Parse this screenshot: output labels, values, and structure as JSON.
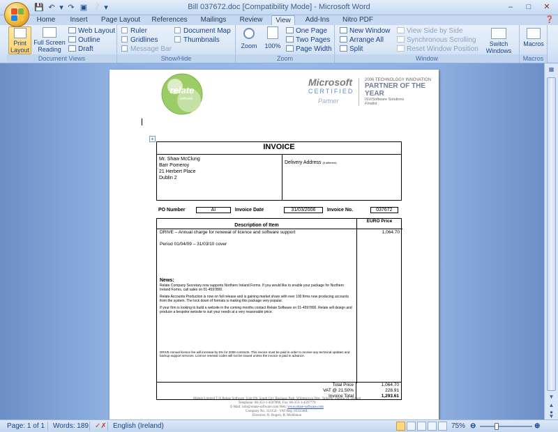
{
  "window": {
    "title": "Bill 037672.doc [Compatibility Mode] - Microsoft Word"
  },
  "tabs": [
    "Home",
    "Insert",
    "Page Layout",
    "References",
    "Mailings",
    "Review",
    "View",
    "Add-Ins",
    "Nitro PDF"
  ],
  "active_tab": "View",
  "ribbon": {
    "document_views": {
      "name": "Document Views",
      "print_layout": "Print Layout",
      "full_screen": "Full Screen Reading",
      "web_layout": "Web Layout",
      "outline": "Outline",
      "draft": "Draft"
    },
    "show_hide": {
      "name": "Show/Hide",
      "ruler": "Ruler",
      "gridlines": "Gridlines",
      "message_bar": "Message Bar",
      "document_map": "Document Map",
      "thumbnails": "Thumbnails"
    },
    "zoom": {
      "name": "Zoom",
      "zoom": "Zoom",
      "hundred": "100%",
      "one_page": "One Page",
      "two_pages": "Two Pages",
      "page_width": "Page Width"
    },
    "window": {
      "name": "Window",
      "new_window": "New Window",
      "arrange_all": "Arrange All",
      "split": "Split",
      "view_side": "View Side by Side",
      "sync_scroll": "Synchronous Scrolling",
      "reset_pos": "Reset Window Position",
      "switch_windows": "Switch Windows"
    },
    "macros": {
      "name": "Macros",
      "macros": "Macros"
    }
  },
  "document": {
    "logo_text": "relate",
    "logo_sub": "software",
    "ms_line1": "Microsoft",
    "ms_line2": "CERTIFIED",
    "ms_line3": "Partner",
    "award_line1": "2006 TECHNOLOGY INNOVATION",
    "award_line2": "PARTNER OF THE YEAR",
    "award_line3": "ISV/Software Solutions",
    "award_line4": "Finalist",
    "invoice_title": "INVOICE",
    "address": [
      "Mr. Shaw McClung",
      "Barr Pomeroy",
      "21 Herbert Place",
      "Dublin 2"
    ],
    "delivery_label": "Delivery Address",
    "delivery_note": "(if different)",
    "po_label": "PO Number",
    "po_value": "AI",
    "date_label": "Invoice Date",
    "date_value": "31/03/2006",
    "invno_label": "Invoice No.",
    "invno_value": "037672",
    "col_desc": "Description of Item",
    "col_price": "EURO Price",
    "item_line": "DRIVE – Annual charge for renewal of licence and software support",
    "item_price": "1,064.70",
    "period": "Period 01/04/09 – 31/03/10 cover",
    "news_title": "News:",
    "news1": "Relate Company Secretary now supports Northern Ireland Forms. If you would like to enable your package for Northern Ireland Forms, call sales on 01-4597800.",
    "news2": "Relate Accounts Production is now on full release and is gaining market share with over 100 firms now producing accounts from the system. The lock down of formats is making this package very popular.",
    "news3": "If your firm is looking to build a website in the coming months contact Relate Software on 01-4597800. Relate will design and produce a bespoke website to suit your needs at a very reasonable price.",
    "fine_print": "DRIVE Annual licence fee will increase by 5% for 2008 contracts. This invoice must be paid in order to receive any technical updates and backup support services. Licence renewal codes will not be issued unless the invoice is paid in advance.",
    "total_label": "Total Price",
    "total_value": "1,064.70",
    "vat_label": "VAT @ 21.50%",
    "vat_value": "228.91",
    "invtotal_label": "Invoice Total",
    "invtotal_value": "1,293.61",
    "footer1": "Mabnk Limited T/A Relate Software, Unit D6, South City Business Park, Whitestown Way, Tallaght, Dublin 24, Ireland",
    "footer2": "Telephone: 00-353-1-4597800, Fax: 00-353-1-4597779",
    "footer3_pre": "E-Mail: info@relate-software.com Web:",
    "footer3_link": "www.relate-software.com",
    "footer4": "Company No. 313154 - VAT Reg. 8333348L",
    "footer5": "Directors: R. Rogers, R. McMahon"
  },
  "status": {
    "page": "Page: 1 of 1",
    "words": "Words: 189",
    "language": "English (Ireland)",
    "zoom": "75%"
  },
  "colors": {
    "accent": "#15428b",
    "ribbon_bg": "#dbe7f6",
    "doc_bg": "#8fb0e0"
  }
}
